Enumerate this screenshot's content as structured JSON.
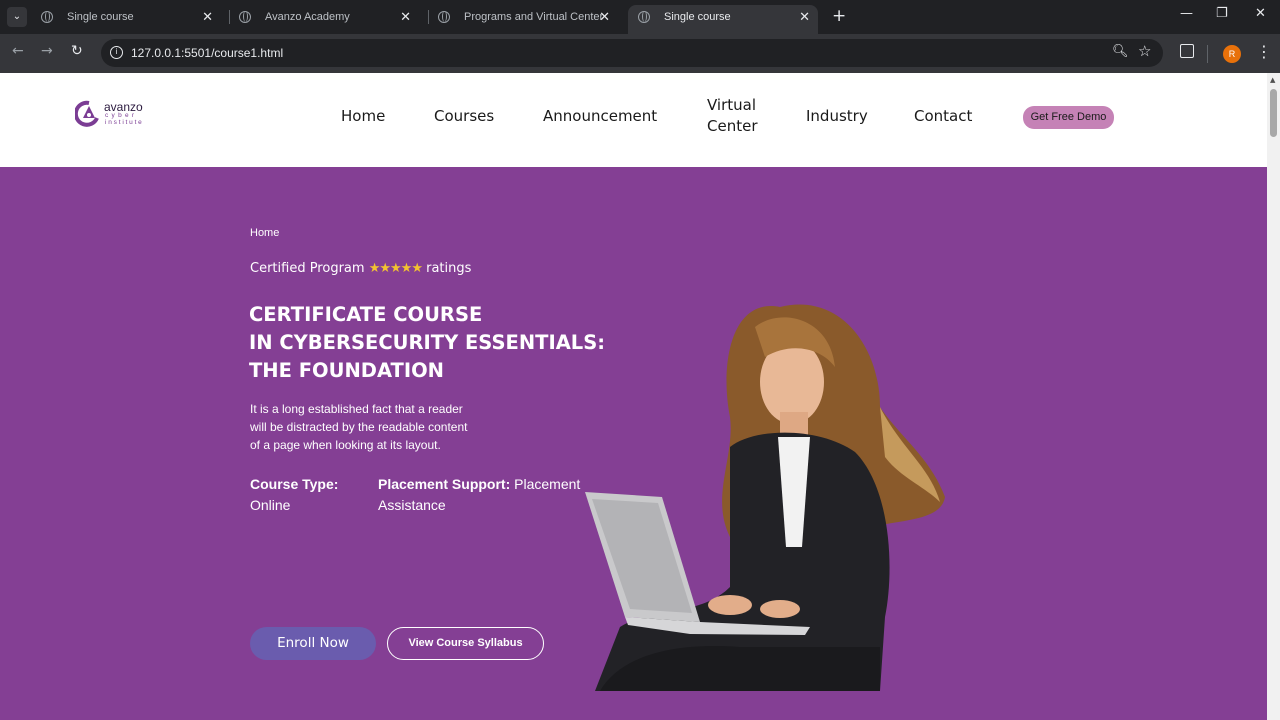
{
  "browser": {
    "tabs": [
      {
        "title": "Single course",
        "active": false
      },
      {
        "title": "Avanzo Academy",
        "active": false
      },
      {
        "title": "Programs and Virtual Center",
        "active": false
      },
      {
        "title": "Single course",
        "active": true
      }
    ],
    "url": "127.0.0.1:5501/course1.html",
    "profile_initial": "R"
  },
  "site": {
    "logo": {
      "line1": "avanzo",
      "line2": "cyber",
      "line3": "institute"
    },
    "nav": {
      "home": "Home",
      "courses": "Courses",
      "announcement": "Announcement",
      "virtual_line1": "Virtual",
      "virtual_line2": "Center",
      "industry": "Industry",
      "contact": "Contact",
      "demo": "Get Free Demo"
    },
    "colors": {
      "hero_bg": "#843f94",
      "demo_btn": "#c582b6",
      "enroll_btn": "#6a5cae",
      "stars": "#f2c230"
    }
  },
  "hero": {
    "breadcrumb": "Home",
    "certified_prefix": "Certified Program",
    "stars": "★★★★★",
    "certified_suffix": "ratings",
    "title_lines": [
      "CERTIFICATE COURSE",
      "IN CYBERSECURITY ESSENTIALS:",
      "THE FOUNDATION"
    ],
    "description_lines": [
      "It is a long established fact that a reader",
      "will be distracted by the readable content",
      "of a page when looking at its layout."
    ],
    "course_type_label": "Course Type:",
    "course_type_value": "Online",
    "placement_label": "Placement Support:",
    "placement_value_1": "Placement",
    "placement_value_2": "Assistance",
    "enroll": "Enroll Now",
    "syllabus": "View Course Syllabus",
    "image_subject": "woman-with-laptop-photo"
  }
}
